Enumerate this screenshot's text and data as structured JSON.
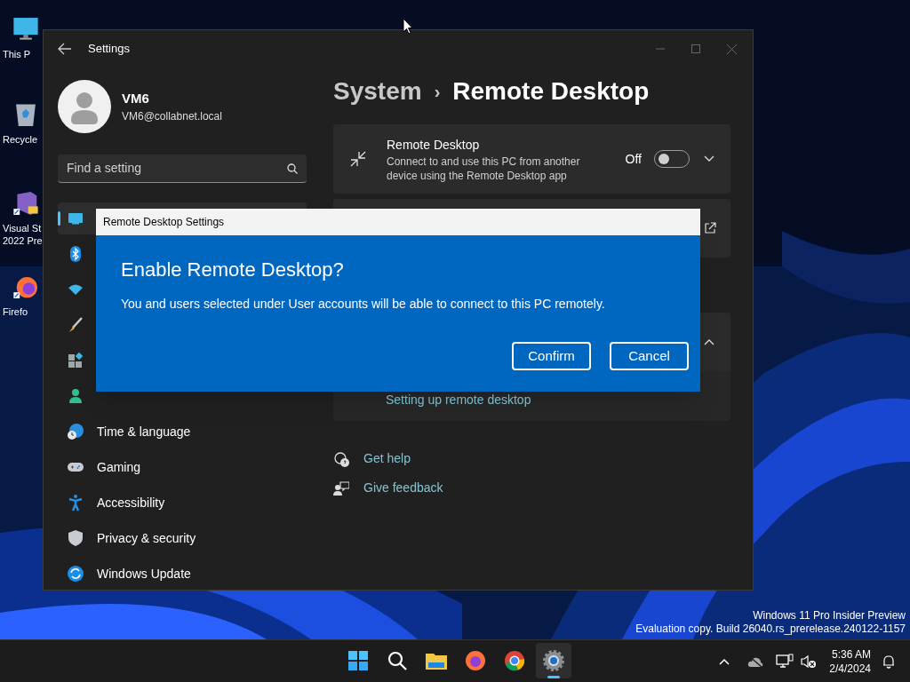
{
  "desktop_icons": [
    {
      "label": "This P"
    },
    {
      "label": "Recycle"
    },
    {
      "label": "Visual St\n2022 Pre"
    },
    {
      "label": "Firefo"
    }
  ],
  "settings_window": {
    "title": "Settings",
    "account": {
      "name": "VM6",
      "email": "VM6@collabnet.local"
    },
    "search": {
      "placeholder": "Find a setting"
    },
    "sidebar": {
      "items": [
        {
          "selected": true
        },
        {
          "selected": false
        },
        {
          "selected": false
        },
        {
          "selected": false
        },
        {
          "selected": false
        },
        {
          "selected": false
        },
        {
          "label": "Time & language",
          "selected": false
        },
        {
          "label": "Gaming",
          "selected": false
        },
        {
          "label": "Accessibility",
          "selected": false
        },
        {
          "label": "Privacy & security",
          "selected": false
        },
        {
          "label": "Windows Update",
          "selected": false
        }
      ]
    },
    "breadcrumb": {
      "parent": "System",
      "separator": "›",
      "current": "Remote Desktop"
    },
    "remote_desktop_card": {
      "title": "Remote Desktop",
      "description": "Connect to and use this PC from another device using the Remote Desktop app",
      "state_label": "Off",
      "on": false,
      "expanded": false
    },
    "user_accounts_card": {
      "expanded": true,
      "link": "Setting up remote desktop"
    },
    "links": [
      "Get help",
      "Give feedback"
    ]
  },
  "dialog": {
    "title": "Remote Desktop Settings",
    "heading": "Enable Remote Desktop?",
    "message": "You and users selected under User accounts will be able to connect to this PC remotely.",
    "buttons": [
      "Confirm",
      "Cancel"
    ]
  },
  "watermark_lines": [
    "Windows 11 Pro Insider Preview",
    "Evaluation copy. Build 26040.rs_prerelease.240122-1157"
  ],
  "taskbar": {
    "apps": [
      {
        "selected": false
      },
      {
        "selected": false
      },
      {
        "selected": false
      },
      {
        "selected": false
      },
      {
        "selected": false
      },
      {
        "selected": true
      }
    ],
    "time": "5:36 AM",
    "date": "2/4/2024"
  }
}
